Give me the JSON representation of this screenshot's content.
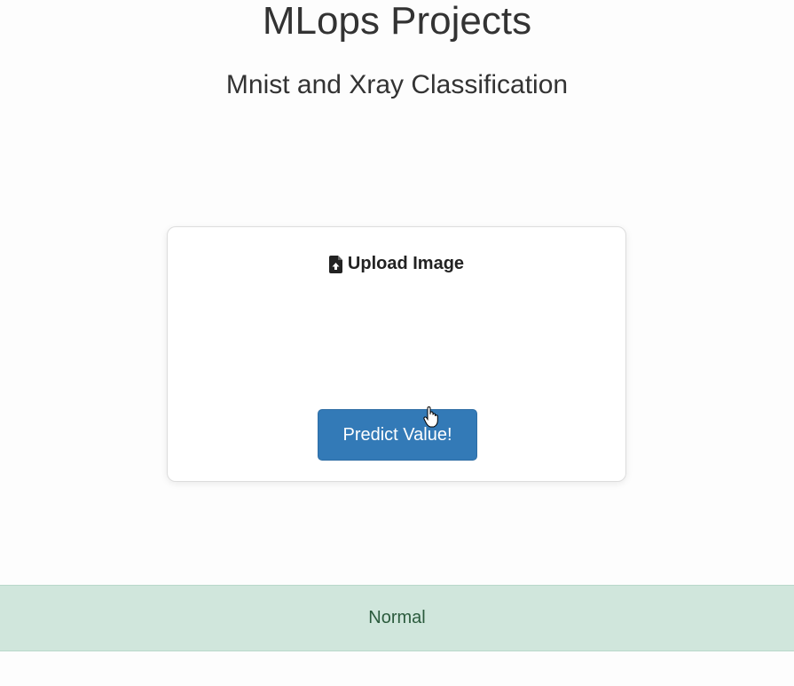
{
  "header": {
    "title": "MLops Projects",
    "subtitle": "Mnist and Xray Classification"
  },
  "upload_card": {
    "icon": "file-upload-icon",
    "label": "Upload Image",
    "predict_button_label": "Predict Value!"
  },
  "result": {
    "text": "Normal"
  },
  "colors": {
    "primary_button": "#337ab7",
    "result_background": "#d0e6dc",
    "result_text": "#2b5b3d"
  }
}
